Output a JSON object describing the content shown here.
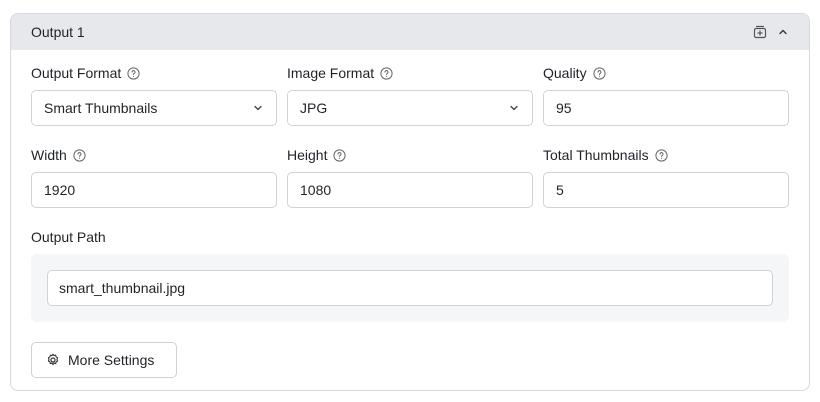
{
  "panel": {
    "title": "Output 1"
  },
  "fields": {
    "output_format": {
      "label": "Output Format",
      "value": "Smart Thumbnails"
    },
    "image_format": {
      "label": "Image Format",
      "value": "JPG"
    },
    "quality": {
      "label": "Quality",
      "value": "95"
    },
    "width": {
      "label": "Width",
      "value": "1920"
    },
    "height": {
      "label": "Height",
      "value": "1080"
    },
    "total_thumbnails": {
      "label": "Total Thumbnails",
      "value": "5"
    },
    "output_path": {
      "label": "Output Path",
      "value": "smart_thumbnail.jpg"
    }
  },
  "actions": {
    "more_settings_label": "More Settings"
  },
  "icons": {
    "header": [
      "copy-add-icon",
      "chevron-up-icon"
    ],
    "help": "help-circle-icon",
    "dropdown": "chevron-down-icon",
    "settings": "gear-icon"
  }
}
